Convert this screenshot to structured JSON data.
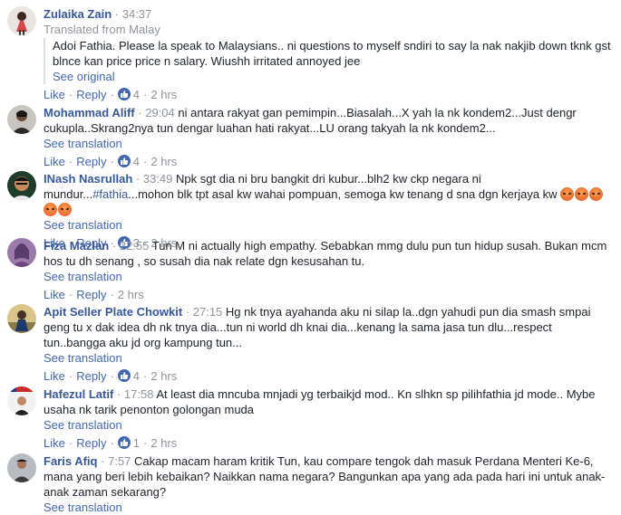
{
  "labels": {
    "like": "Like",
    "reply": "Reply",
    "see_translation": "See translation",
    "see_original": "See original",
    "translated_from": "Translated from Malay"
  },
  "colors": {
    "name": "#365899",
    "link": "#4267b2",
    "meta": "#90949c",
    "text": "#1d2129"
  },
  "comments": [
    {
      "name": "Zulaika Zain",
      "time": "34:37",
      "text": "Adoi Fathia. Please la speak to Malaysians.. ni questions to myself sndiri to say la nak nakjib down tknk gst blnce kan price price n salary. Wiushh irritated annoyed jee",
      "likes": "4",
      "age": "2 hrs"
    },
    {
      "name": "Mohammad Aliff",
      "time": "29:04",
      "text": "ni antara rakyat gan pemimpin...Biasalah...X yah la nk kondem2...Just dengr cukupla..Skrang2nya tun dengar luahan hati rakyat...LU orang takyah la nk kondem2...",
      "likes": "4",
      "age": "2 hrs"
    },
    {
      "name": "INash Nasrullah",
      "time": "33:49",
      "text_a": "Npk sgt dia ni bru bangkit dri kubur...blh2 kw ckp negara ni mundur...",
      "hashtag": "#fathia",
      "text_b": "...mohon blk tpt asal kw wahai pompuan, semoga kw tenang d sna dgn kerjaya kw",
      "likes": "3",
      "age": "2 hrs"
    },
    {
      "name": "Fiza Mazlan",
      "time": "22:55",
      "text": "Tun M ni actually high empathy. Sebabkan mmg dulu pun tun hidup susah. Bukan mcm hos tu dh senang , so susah dia nak relate dgn kesusahan tu.",
      "age": "2 hrs"
    },
    {
      "name": "Apit Seller Plate Chowkit",
      "time": "27:15",
      "text": "Hg nk tnya ayahanda aku ni silap la..dgn yahudi pun dia smash smpai geng tu x dak idea dh nk tnya dia...tun ni world dh knai dia...kenang la sama jasa tun dlu...respect tun..bangga aku jd org kampung tun...",
      "likes": "4",
      "age": "2 hrs"
    },
    {
      "name": "Hafezul Latif",
      "time": "17:58",
      "text": "At least dia mncuba mnjadi yg terbaikjd mod.. Kn slhkn sp pilihfathia jd mode.. Mybe usaha nk tarik penonton golongan muda",
      "likes": "1",
      "age": "2 hrs"
    },
    {
      "name": "Faris Afiq",
      "time": "7:57",
      "text": "Cakap macam haram kritik Tun, kau compare tengok dah masuk Perdana Menteri Ke-6, mana yang beri lebih kebaikan? Naikkan nama negara? Bangunkan apa yang ada pada hari ini untuk anak-anak zaman sekarang?"
    }
  ]
}
